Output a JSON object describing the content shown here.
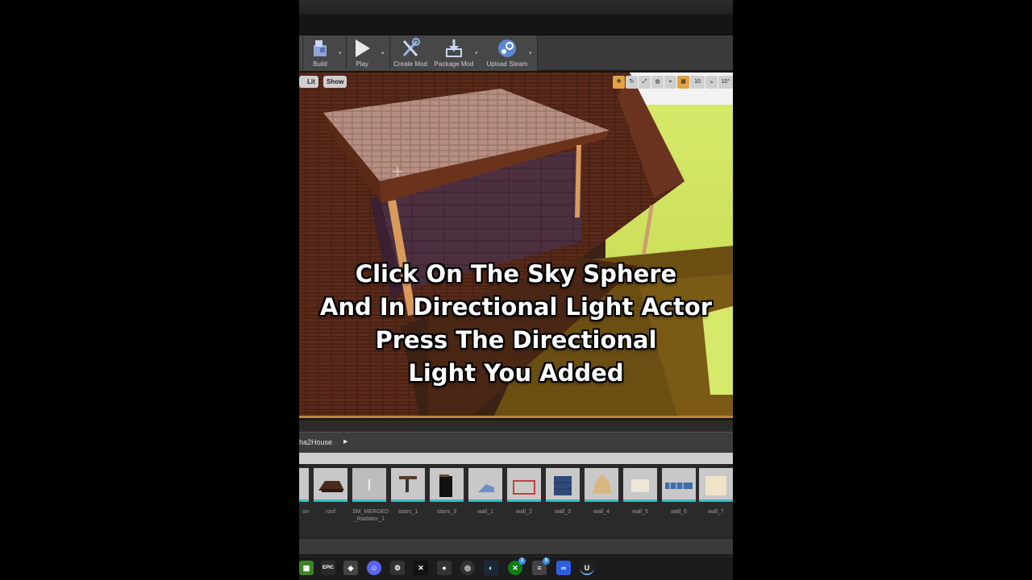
{
  "toolbar": {
    "buttons": [
      {
        "label": "Build",
        "icon": "build-icon"
      },
      {
        "label": "Play",
        "icon": "play-icon"
      },
      {
        "label": "Create Mod",
        "icon": "create-mod-icon"
      },
      {
        "label": "Package Mod",
        "icon": "package-mod-icon"
      },
      {
        "label": "Upload Steam",
        "icon": "steam-icon"
      }
    ]
  },
  "viewport": {
    "lit_label": "Lit",
    "show_label": "Show",
    "grid_snap": "10",
    "rotate_snap": "10°"
  },
  "caption": {
    "lines": [
      "Click On The Sky Sphere",
      "And In Directional Light Actor",
      "Press The Directional",
      "Light You Added"
    ]
  },
  "content_browser": {
    "path": "ha2House",
    "assets": [
      {
        "name": "on"
      },
      {
        "name": "roof"
      },
      {
        "name": "SM_MERGED\n_Radiator_1"
      },
      {
        "name": "stairs_1"
      },
      {
        "name": "stairs_3"
      },
      {
        "name": "wall_1"
      },
      {
        "name": "wall_2"
      },
      {
        "name": "wall_3"
      },
      {
        "name": "wall_4"
      },
      {
        "name": "wall_5"
      },
      {
        "name": "wall_6"
      },
      {
        "name": "wall_7"
      }
    ]
  },
  "taskbar": {
    "icons": [
      {
        "name": "minecraft-icon",
        "color": "#3c8527"
      },
      {
        "name": "epic-games-icon",
        "color": "#2a2a2a"
      },
      {
        "name": "roblox-icon",
        "color": "#444444"
      },
      {
        "name": "discord-icon",
        "color": "#5865f2"
      },
      {
        "name": "settings-icon",
        "color": "#333333"
      },
      {
        "name": "capcut-icon",
        "color": "#111111"
      },
      {
        "name": "dog-icon",
        "color": "#333333"
      },
      {
        "name": "obs-icon",
        "color": "#333333"
      },
      {
        "name": "steam-icon",
        "color": "#1b2838"
      },
      {
        "name": "xbox-icon",
        "color": "#107c10",
        "badge": "1"
      },
      {
        "name": "stack-icon",
        "color": "#444444",
        "badge": "5"
      },
      {
        "name": "meta-icon",
        "color": "#2f5de0"
      },
      {
        "name": "unreal-icon",
        "color": "#222222"
      }
    ]
  }
}
